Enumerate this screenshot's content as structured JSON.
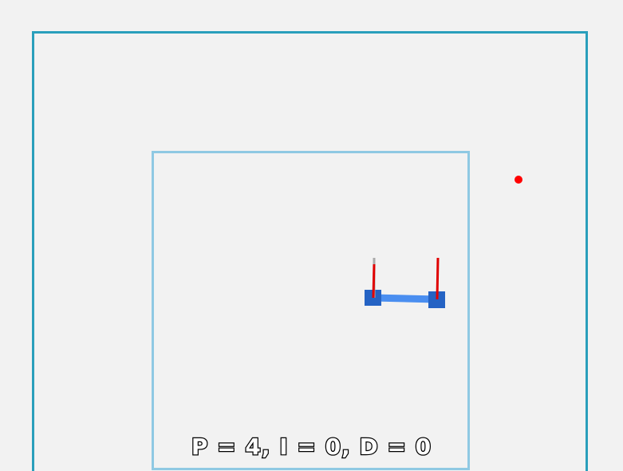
{
  "hud": {
    "pid_text": "P = 4, I = 0, D = 0"
  },
  "colors": {
    "background": "#f2f2f2",
    "outer_boundary": "#2a9fbc",
    "inner_boundary": "#8fc9e3",
    "target": "#ff0000",
    "robot_body": "#2563c4",
    "robot_link": "#4a8ef0",
    "force_vector": "#e00000",
    "reference_vector": "#aaaaaa"
  }
}
